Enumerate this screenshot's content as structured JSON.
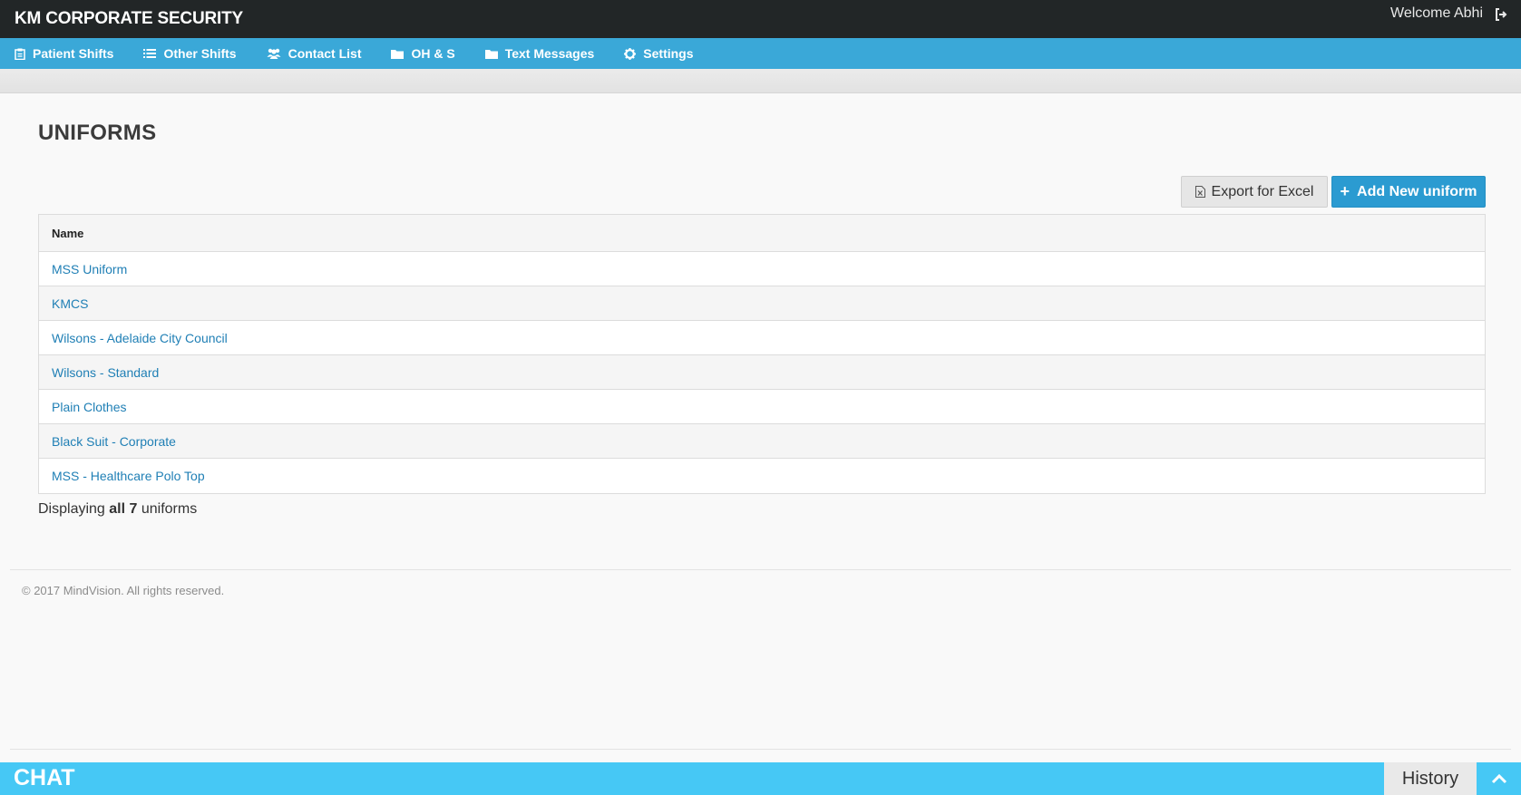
{
  "header": {
    "brand": "KM CORPORATE SECURITY",
    "welcome": "Welcome Abhi"
  },
  "nav": {
    "items": [
      {
        "label": "Patient Shifts",
        "icon": "clipboard-icon"
      },
      {
        "label": "Other Shifts",
        "icon": "list-icon"
      },
      {
        "label": "Contact List",
        "icon": "users-icon"
      },
      {
        "label": "OH & S",
        "icon": "folder-icon"
      },
      {
        "label": "Text Messages",
        "icon": "folder-icon"
      },
      {
        "label": "Settings",
        "icon": "gear-icon"
      }
    ]
  },
  "page": {
    "title": "UNIFORMS",
    "export_label": "Export for Excel",
    "add_label": "Add New uniform",
    "add_prefix": "+"
  },
  "table": {
    "header": "Name",
    "rows": [
      "MSS Uniform",
      "KMCS",
      "Wilsons - Adelaide City Council",
      "Wilsons - Standard",
      "Plain Clothes",
      "Black Suit - Corporate",
      "MSS - Healthcare Polo Top"
    ]
  },
  "summary": {
    "prefix": "Displaying",
    "bold": "all 7",
    "suffix": "uniforms"
  },
  "footer": {
    "copyright": "© 2017 MindVision. All rights reserved."
  },
  "chat": {
    "label": "CHAT",
    "history": "History"
  },
  "colors": {
    "topbar": "#222627",
    "nav": "#3aa8d8",
    "primary_button": "#2b9bd1",
    "link": "#1f7fb5",
    "chat": "#46c8f5"
  }
}
